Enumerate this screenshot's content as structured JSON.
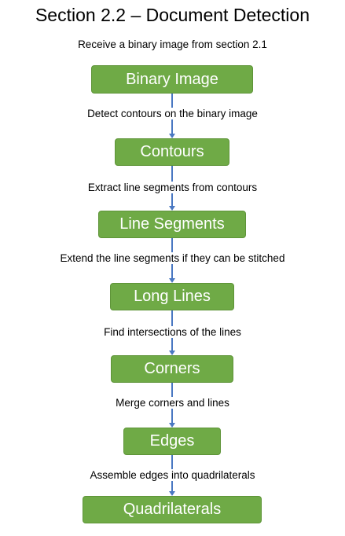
{
  "title": "Section 2.2 – Document Detection",
  "subtitle": "Receive a binary image from section 2.1",
  "colors": {
    "node_fill": "#6faa46",
    "node_text": "#ffffff",
    "arrow": "#4a78c2"
  },
  "steps": [
    {
      "label": "Binary Image"
    },
    {
      "label": "Contours"
    },
    {
      "label": "Line Segments"
    },
    {
      "label": "Long Lines"
    },
    {
      "label": "Corners"
    },
    {
      "label": "Edges"
    },
    {
      "label": "Quadrilaterals"
    }
  ],
  "transitions": [
    "Detect contours on the binary image",
    "Extract line segments from contours",
    "Extend the line segments if they can be stitched",
    "Find intersections of the lines",
    "Merge corners and lines",
    "Assemble edges into quadrilaterals"
  ]
}
